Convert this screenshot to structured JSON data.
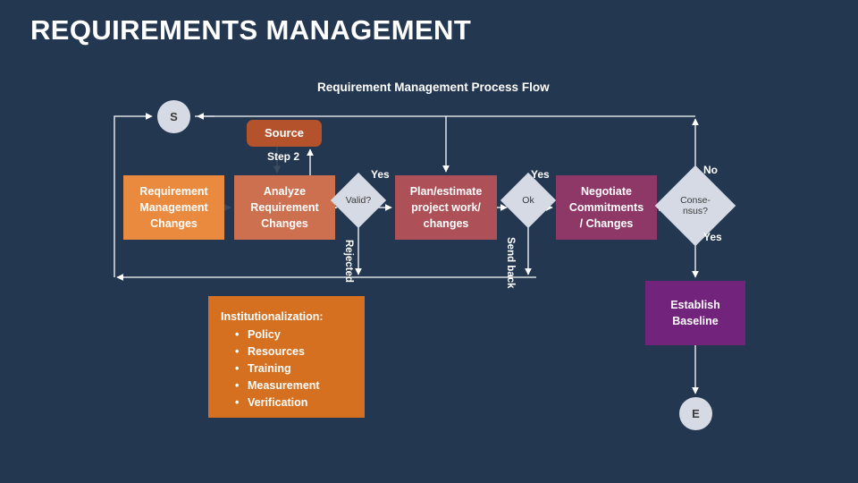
{
  "slide": {
    "title": "REQUIREMENTS MANAGEMENT",
    "background_color": "#233750"
  },
  "diagram": {
    "title": "Requirement Management Process Flow",
    "type": "flowchart",
    "terminators": [
      {
        "id": "start",
        "label": "S",
        "fill": "#d5dae5",
        "text_color": "#3a3a3a"
      },
      {
        "id": "end",
        "label": "E",
        "fill": "#d5dae5",
        "text_color": "#3a3a3a"
      }
    ],
    "nodes": [
      {
        "id": "source",
        "label": "Source",
        "fill": "#b4522c",
        "shape": "rounded-rect"
      },
      {
        "id": "requirement-management-changes",
        "label": "Requirement Management Changes",
        "lines": [
          "Requirement",
          "Management",
          "Changes"
        ],
        "fill": "#ea8a3e",
        "shape": "rect"
      },
      {
        "id": "analyze-requirement-changes",
        "label": "Analyze Requirement Changes",
        "lines": [
          "Analyze",
          "Requirement",
          "Changes"
        ],
        "fill": "#cc7050",
        "shape": "rect"
      },
      {
        "id": "plan-estimate",
        "label": "Plan/estimate project work/ changes",
        "lines": [
          "Plan/estimate",
          "project work/",
          "changes"
        ],
        "fill": "#ae5058",
        "shape": "rect"
      },
      {
        "id": "negotiate-commitments",
        "label": "Negotiate Commitments / Changes",
        "lines": [
          "Negotiate",
          "Commitments",
          "/ Changes"
        ],
        "fill": "#8e3868",
        "shape": "rect"
      },
      {
        "id": "establish-baseline",
        "label": "Establish Baseline",
        "lines": [
          "Establish",
          "Baseline"
        ],
        "fill": "#72237c",
        "shape": "rect"
      }
    ],
    "decisions": [
      {
        "id": "valid",
        "label": "Valid?",
        "lines": [
          "Valid?"
        ],
        "fill": "#d5dae5",
        "text_color": "#3a3a3a"
      },
      {
        "id": "ok",
        "label": "Ok",
        "lines": [
          "Ok"
        ],
        "fill": "#d5dae5",
        "text_color": "#3a3a3a"
      },
      {
        "id": "consensus",
        "label": "Consensus?",
        "lines": [
          "Conse-",
          "nsus?"
        ],
        "fill": "#d5dae5",
        "text_color": "#3a3a3a"
      }
    ],
    "edge_labels": {
      "step2": "Step 2",
      "valid_yes": "Yes",
      "valid_rejected": "Rejected",
      "ok_yes": "Yes",
      "ok_send_back": "Send back",
      "consensus_no": "No",
      "consensus_yes": "Yes"
    },
    "callout": {
      "heading": "Institutionalization:",
      "fill": "#d4701f",
      "items": [
        "Policy",
        "Resources",
        "Training",
        "Measurement",
        "Verification"
      ]
    },
    "connector_color": "#ffffff",
    "step2_connector_color": "#3b4a5e"
  }
}
